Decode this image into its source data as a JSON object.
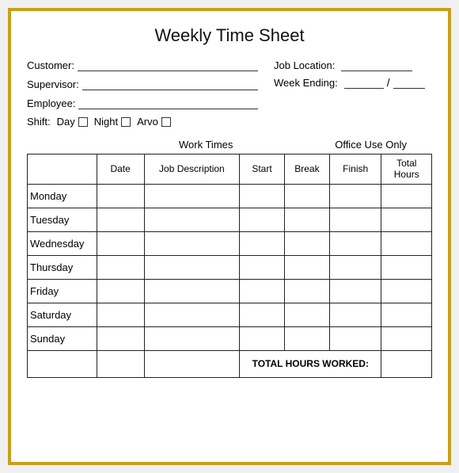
{
  "title": "Weekly Time Sheet",
  "form": {
    "customer_label": "Customer:",
    "supervisor_label": "Supervisor:",
    "employee_label": "Employee:",
    "shift_label": "Shift:",
    "shift_options": [
      "Day",
      "Night",
      "Arvo"
    ],
    "job_location_label": "Job Location:",
    "week_ending_label": "Week Ending:"
  },
  "work_times_label": "Work Times",
  "office_use_label": "Office Use Only",
  "table": {
    "headers": [
      "",
      "Date",
      "Job Description",
      "Start",
      "Break",
      "Finish",
      "Total\nHours"
    ],
    "days": [
      "Monday",
      "Tuesday",
      "Wednesday",
      "Thursday",
      "Friday",
      "Saturday",
      "Sunday"
    ],
    "total_row_label": "TOTAL HOURS WORKED:"
  }
}
